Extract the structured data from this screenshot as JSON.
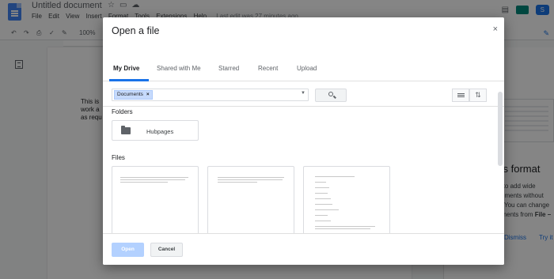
{
  "app": {
    "doc_title": "Untitled document",
    "menu": [
      "File",
      "Edit",
      "View",
      "Insert",
      "Format",
      "Tools",
      "Extensions",
      "Help"
    ],
    "last_edit": "Last edit was 27 minutes ago",
    "share_label": "S",
    "zoom": "100%",
    "doc_text": [
      "This is",
      "work a",
      "as requ"
    ],
    "side_panel": {
      "title": "ss format",
      "desc": [
        "u to add wide",
        "cuments without",
        "You can change",
        "ements from"
      ],
      "desc_bold": "File –",
      "dismiss": "Dismiss",
      "try": "Try it"
    }
  },
  "dialog": {
    "title": "Open a file",
    "close_glyph": "×",
    "tabs": [
      {
        "label": "My Drive",
        "active": true
      },
      {
        "label": "Shared with Me",
        "active": false
      },
      {
        "label": "Starred",
        "active": false
      },
      {
        "label": "Recent",
        "active": false
      },
      {
        "label": "Upload",
        "active": false
      }
    ],
    "search": {
      "chip": "Documents",
      "chip_remove": "×",
      "caret": "▼"
    },
    "folders_label": "Folders",
    "folders": [
      "Hubpages"
    ],
    "files_label": "Files",
    "footer": {
      "open_label": "Open",
      "cancel_label": "Cancel"
    }
  },
  "colors": {
    "accent": "#1a73e8",
    "chip_bg": "#c6dafc",
    "open_disabled": "#b3d1ff",
    "scrim": "rgba(0,0,0,0.48)"
  }
}
